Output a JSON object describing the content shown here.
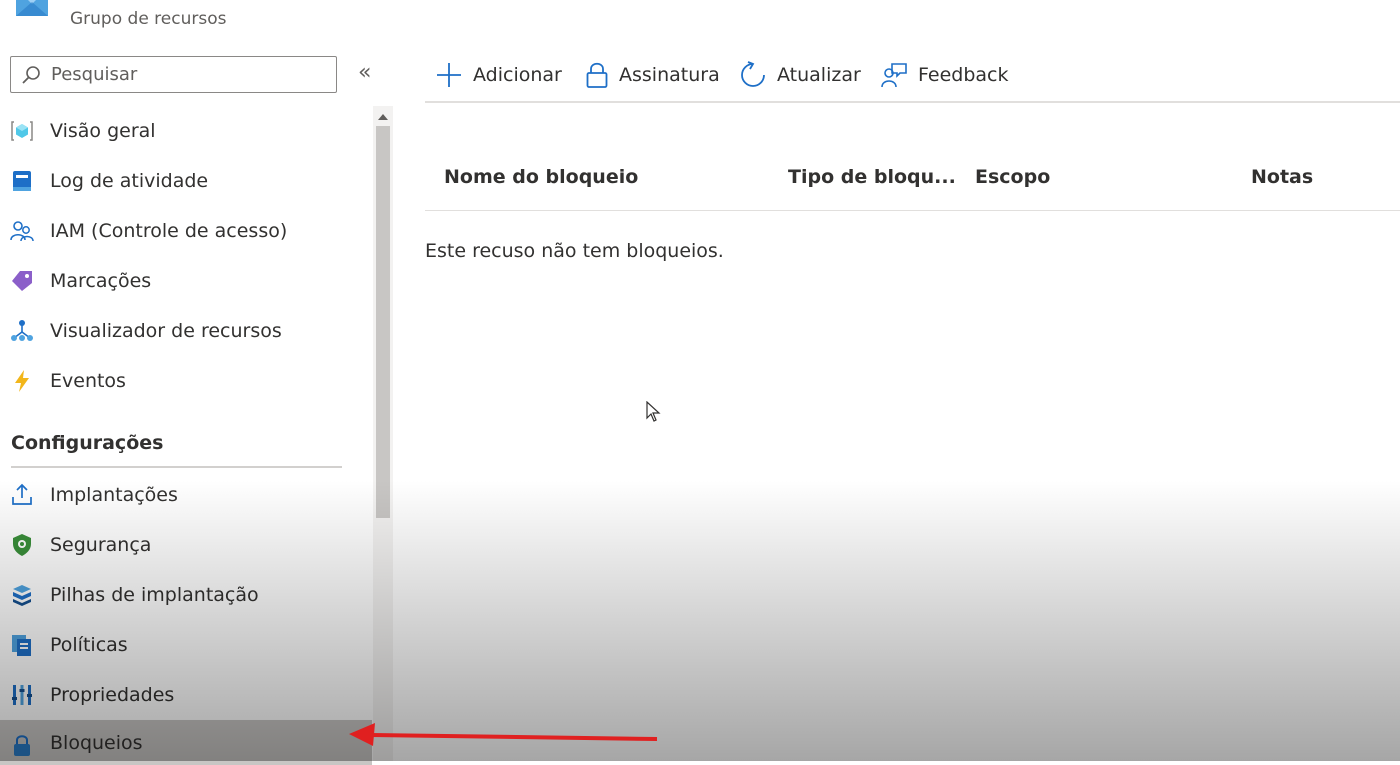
{
  "header": {
    "subtitle": "Grupo de recursos"
  },
  "sidebar": {
    "search_placeholder": "Pesquisar",
    "collapse_glyph": "«",
    "items": [
      {
        "label": "Visão geral",
        "icon": "cube-icon"
      },
      {
        "label": "Log de atividade",
        "icon": "log-book-icon"
      },
      {
        "label": "IAM (Controle de acesso)",
        "icon": "people-icon"
      },
      {
        "label": "Marcações",
        "icon": "tag-icon"
      },
      {
        "label": "Visualizador de recursos",
        "icon": "hierarchy-icon"
      },
      {
        "label": "Eventos",
        "icon": "lightning-icon"
      }
    ],
    "section_title": "Configurações",
    "config_items": [
      {
        "label": "Implantações",
        "icon": "upload-icon"
      },
      {
        "label": "Segurança",
        "icon": "shield-icon"
      },
      {
        "label": "Pilhas de implantação",
        "icon": "stack-icon"
      },
      {
        "label": "Políticas",
        "icon": "policy-icon"
      },
      {
        "label": "Propriedades",
        "icon": "properties-icon"
      },
      {
        "label": "Bloqueios",
        "icon": "lock-icon",
        "selected": true
      }
    ]
  },
  "toolbar": {
    "add_label": "Adicionar",
    "subscription_label": "Assinatura",
    "refresh_label": "Atualizar",
    "feedback_label": "Feedback"
  },
  "table": {
    "columns": [
      "Nome do bloqueio",
      "Tipo de bloqu...",
      "Escopo",
      "Notas"
    ],
    "empty_message": "Este recuso não tem bloqueios."
  },
  "colors": {
    "accent": "#0078d4",
    "selected_bg": "#c8c6c4",
    "annotation_arrow": "#e02020"
  }
}
